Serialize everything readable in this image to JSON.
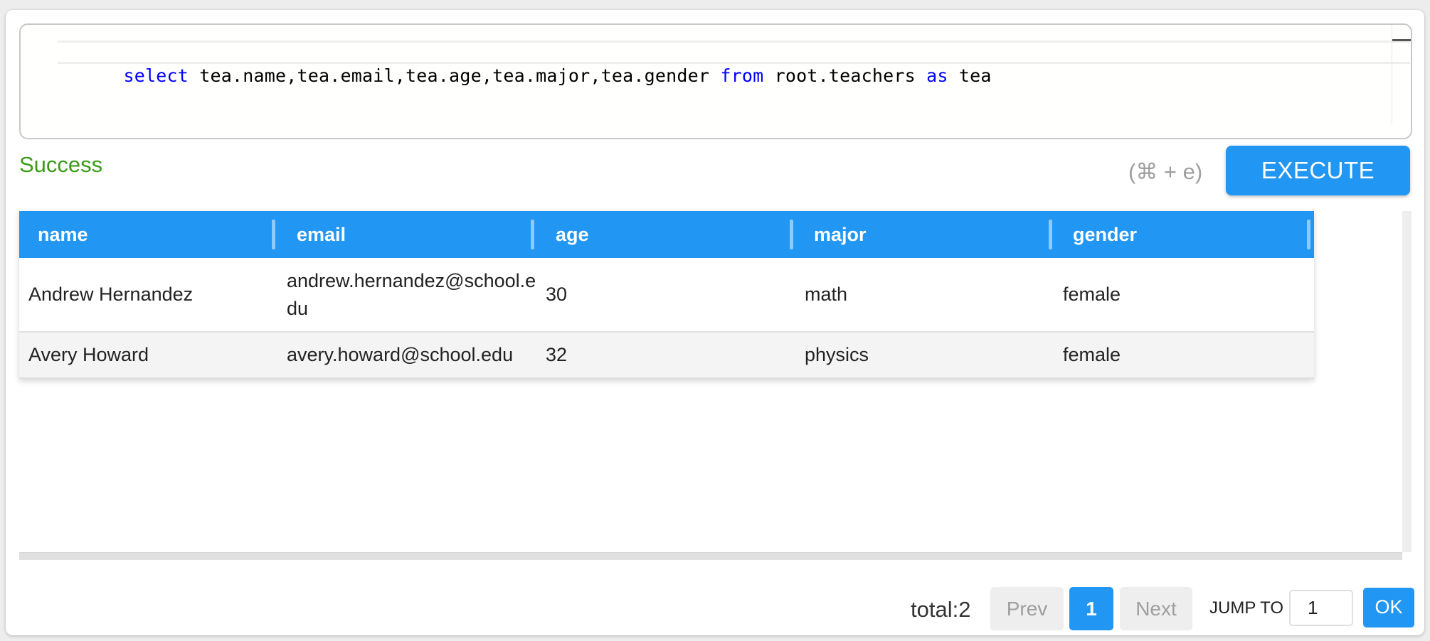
{
  "editor": {
    "tokens": [
      {
        "text": "select",
        "kind": "keyword"
      },
      {
        "text": " tea.name,tea.email,tea.age,tea.major,tea.gender ",
        "kind": "plain"
      },
      {
        "text": "from",
        "kind": "keyword"
      },
      {
        "text": " root.teachers ",
        "kind": "plain"
      },
      {
        "text": "as",
        "kind": "keyword"
      },
      {
        "text": " tea",
        "kind": "plain"
      }
    ]
  },
  "status": {
    "message": "Success",
    "color": "#3a9c16"
  },
  "execute": {
    "shortcut": "(⌘ + e)",
    "label": "EXECUTE"
  },
  "table": {
    "columns": [
      "name",
      "email",
      "age",
      "major",
      "gender"
    ],
    "rows": [
      [
        "Andrew Hernandez",
        "andrew.hernandez@school.edu",
        "30",
        "math",
        "female"
      ],
      [
        "Avery Howard",
        "avery.howard@school.edu",
        "32",
        "physics",
        "female"
      ]
    ]
  },
  "pagination": {
    "total": "total:2",
    "prev": "Prev",
    "current_page": "1",
    "next": "Next",
    "jump_label": "JUMP TO",
    "jump_value": "1",
    "ok": "OK"
  },
  "colors": {
    "accent": "#2196f3",
    "keyword": "#0000ff",
    "success": "#3a9c16"
  }
}
